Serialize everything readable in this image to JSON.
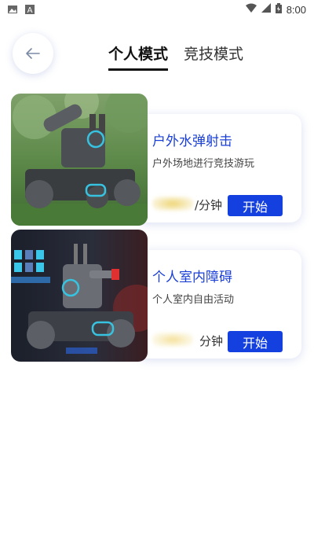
{
  "status_bar": {
    "time": "8:00",
    "icons": [
      "image-icon",
      "a-icon",
      "wifi-icon",
      "signal-icon",
      "battery-icon"
    ]
  },
  "header": {
    "back_icon": "arrow-left-icon",
    "tabs": [
      {
        "label": "个人模式",
        "active": true
      },
      {
        "label": "竞技模式",
        "active": false
      }
    ]
  },
  "cards": [
    {
      "title": "户外水弹射击",
      "description": "户外场地进行竞技游玩",
      "price_unit": "/分钟",
      "start_label": "开始"
    },
    {
      "title": "个人室内障碍",
      "description": "个人室内自由活动",
      "price_unit": "分钟",
      "start_label": "开始"
    }
  ],
  "colors": {
    "accent": "#1540e0",
    "title": "#1a3fd6"
  }
}
